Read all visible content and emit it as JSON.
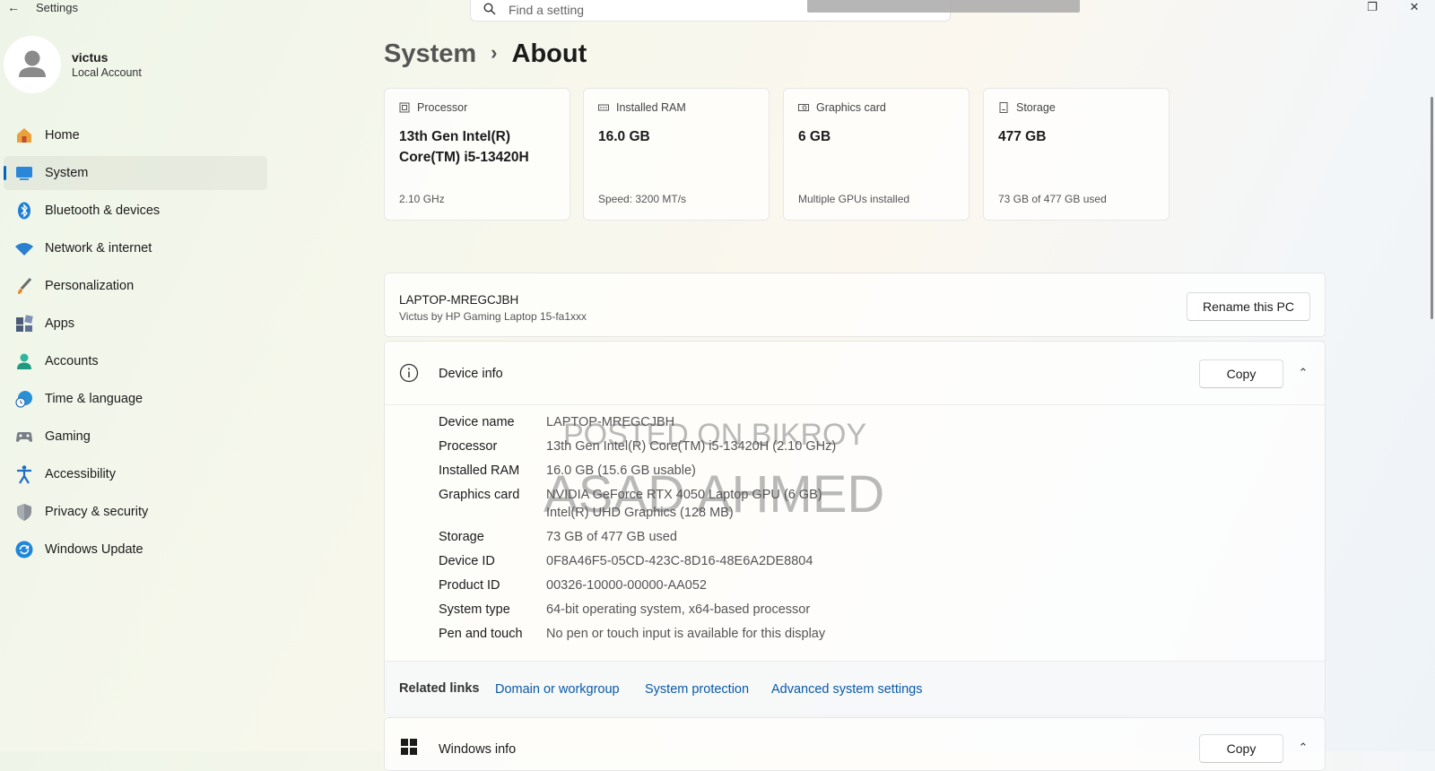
{
  "app": {
    "title": "Settings"
  },
  "search": {
    "placeholder": "Find a setting"
  },
  "profile": {
    "name": "victus",
    "account_type": "Local Account"
  },
  "nav": [
    {
      "label": "Home",
      "icon": "home-icon",
      "active": false
    },
    {
      "label": "System",
      "icon": "system-icon",
      "active": true
    },
    {
      "label": "Bluetooth & devices",
      "icon": "bluetooth-icon",
      "active": false
    },
    {
      "label": "Network & internet",
      "icon": "wifi-icon",
      "active": false
    },
    {
      "label": "Personalization",
      "icon": "brush-icon",
      "active": false
    },
    {
      "label": "Apps",
      "icon": "apps-icon",
      "active": false
    },
    {
      "label": "Accounts",
      "icon": "accounts-icon",
      "active": false
    },
    {
      "label": "Time & language",
      "icon": "clock-globe-icon",
      "active": false
    },
    {
      "label": "Gaming",
      "icon": "controller-icon",
      "active": false
    },
    {
      "label": "Accessibility",
      "icon": "accessibility-icon",
      "active": false
    },
    {
      "label": "Privacy & security",
      "icon": "shield-icon",
      "active": false
    },
    {
      "label": "Windows Update",
      "icon": "update-icon",
      "active": false
    }
  ],
  "breadcrumb": {
    "parent": "System",
    "current": "About"
  },
  "spec_cards": [
    {
      "header": "Processor",
      "value": "13th Gen Intel(R) Core(TM) i5-13420H",
      "footer": "2.10 GHz",
      "icon": "processor-icon"
    },
    {
      "header": "Installed RAM",
      "value": "16.0 GB",
      "footer": "Speed: 3200 MT/s",
      "icon": "ram-icon"
    },
    {
      "header": "Graphics card",
      "value": "6 GB",
      "footer": "Multiple GPUs installed",
      "icon": "graphics-card-icon"
    },
    {
      "header": "Storage",
      "value": "477 GB",
      "footer": "73 GB of 477 GB used",
      "icon": "storage-icon"
    }
  ],
  "pc": {
    "name": "LAPTOP-MREGCJBH",
    "model": "Victus by HP Gaming Laptop 15-fa1xxx",
    "rename_label": "Rename this PC"
  },
  "device_info": {
    "title": "Device info",
    "copy_label": "Copy",
    "rows": [
      {
        "key": "Device name",
        "value": "LAPTOP-MREGCJBH"
      },
      {
        "key": "Processor",
        "value": "13th Gen Intel(R) Core(TM) i5-13420H (2.10 GHz)"
      },
      {
        "key": "Installed RAM",
        "value": "16.0 GB (15.6 GB usable)"
      },
      {
        "key": "Graphics card",
        "value": "NVIDIA GeForce RTX 4050 Laptop GPU (6 GB)",
        "value2": "Intel(R) UHD Graphics (128 MB)"
      },
      {
        "key": "Storage",
        "value": "73 GB of 477 GB used"
      },
      {
        "key": "Device ID",
        "value": "0F8A46F5-05CD-423C-8D16-48E6A2DE8804"
      },
      {
        "key": "Product ID",
        "value": "00326-10000-00000-AA052"
      },
      {
        "key": "System type",
        "value": "64-bit operating system, x64-based processor"
      },
      {
        "key": "Pen and touch",
        "value": "No pen or touch input is available for this display"
      }
    ]
  },
  "related_links": {
    "label": "Related links",
    "links": [
      "Domain or workgroup",
      "System protection",
      "Advanced system settings"
    ]
  },
  "windows_info": {
    "title": "Windows info",
    "copy_label": "Copy"
  },
  "watermarks": [
    "POSTED ON BIKROY",
    "ASAD AHMED"
  ],
  "colors": {
    "accent": "#0067c0",
    "link": "#0a5aa8"
  }
}
